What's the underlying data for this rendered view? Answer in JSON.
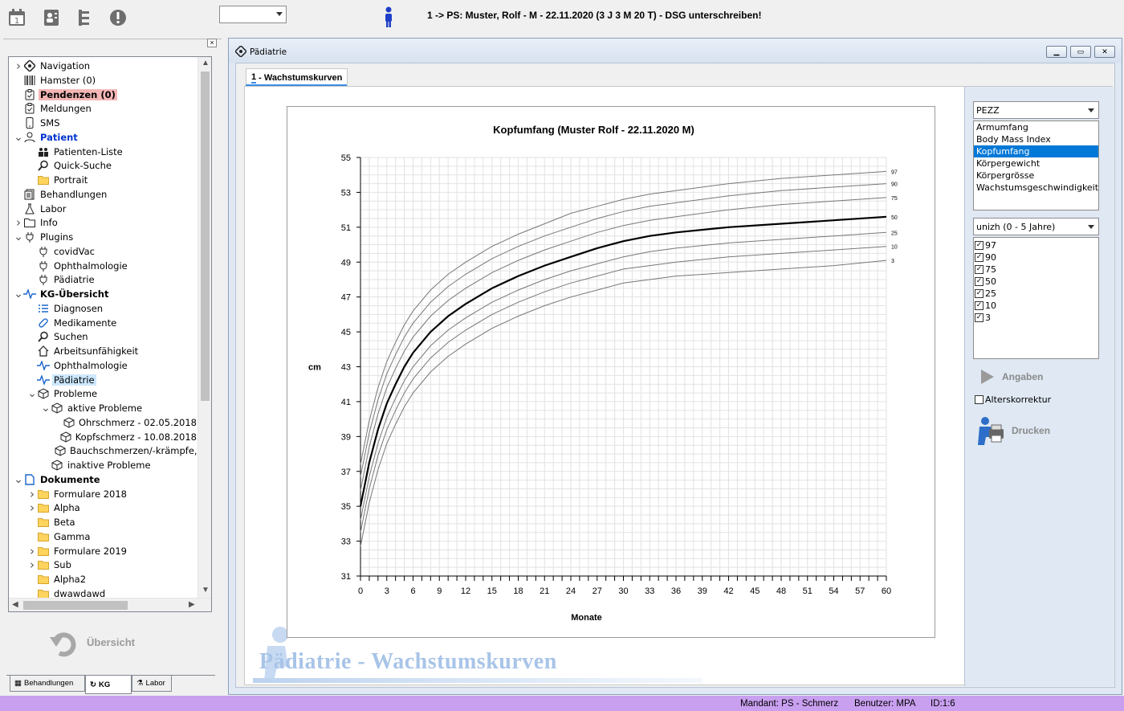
{
  "toolbar": {
    "icons": [
      "calendar-icon",
      "patient-card-icon",
      "tree-icon",
      "alert-icon"
    ],
    "combo_value": "",
    "patient_title": "1 -> PS: Muster, Rolf - M - 22.11.2020 (3 J 3 M 20 T) - DSG unterschreiben!"
  },
  "tree": {
    "items": [
      {
        "label": "Navigation"
      },
      {
        "label": "Hamster (0)"
      },
      {
        "label": "Pendenzen (0)"
      },
      {
        "label": "Meldungen"
      },
      {
        "label": "SMS"
      },
      {
        "label": "Patient"
      },
      {
        "label": "Patienten-Liste"
      },
      {
        "label": "Quick-Suche"
      },
      {
        "label": "Portrait"
      },
      {
        "label": "Behandlungen"
      },
      {
        "label": "Labor"
      },
      {
        "label": "Info"
      },
      {
        "label": "Plugins"
      },
      {
        "label": "covidVac"
      },
      {
        "label": "Ophthalmologie"
      },
      {
        "label": "Pädiatrie"
      },
      {
        "label": "KG-Übersicht"
      },
      {
        "label": "Diagnosen"
      },
      {
        "label": "Medikamente"
      },
      {
        "label": "Suchen"
      },
      {
        "label": "Arbeitsunfähigkeit"
      },
      {
        "label": "Ophthalmologie"
      },
      {
        "label": "Pädiatrie"
      },
      {
        "label": "Probleme"
      },
      {
        "label": "aktive Probleme"
      },
      {
        "label": "Ohrschmerz - 02.05.2018"
      },
      {
        "label": "Kopfschmerz - 10.08.2018"
      },
      {
        "label": "Bauchschmerzen/-krämpfe,"
      },
      {
        "label": "inaktive Probleme"
      },
      {
        "label": "Dokumente"
      },
      {
        "label": "Formulare 2018"
      },
      {
        "label": "Alpha"
      },
      {
        "label": "Beta"
      },
      {
        "label": "Gamma"
      },
      {
        "label": "Formulare 2019"
      },
      {
        "label": "Sub"
      },
      {
        "label": "Alpha2"
      },
      {
        "label": "dwawdawd"
      }
    ]
  },
  "left_bottom": {
    "uebersicht": "Übersicht",
    "tabs": [
      "Behandlungen",
      "KG",
      "Labor"
    ]
  },
  "window": {
    "title": "Pädiatrie",
    "tab_number": "1",
    "tab_label": " - Wachstumskurven",
    "watermark": "Pädiatrie - Wachstumskurven"
  },
  "right": {
    "combo1": "PEZZ",
    "measures": [
      "Armumfang",
      "Body Mass Index",
      "Kopfumfang",
      "Körpergewicht",
      "Körpergrösse",
      "Wachstumsgeschwindigkeit (k"
    ],
    "selected_measure": "Kopfumfang",
    "combo2": "unizh (0 - 5 Jahre)",
    "percentiles": [
      {
        "label": "97",
        "checked": true
      },
      {
        "label": "90",
        "checked": true
      },
      {
        "label": "75",
        "checked": true
      },
      {
        "label": "50",
        "checked": true
      },
      {
        "label": "25",
        "checked": true
      },
      {
        "label": "10",
        "checked": true
      },
      {
        "label": "3",
        "checked": true
      }
    ],
    "angaben": "Angaben",
    "alterskorrektur": "Alterskorrektur",
    "alterskorrektur_checked": false,
    "drucken": "Drucken"
  },
  "chart_data": {
    "type": "line",
    "title": "Kopfumfang (Muster Rolf - 22.11.2020 M)",
    "xlabel": "Monate",
    "ylabel": "cm",
    "xlim": [
      0,
      60
    ],
    "ylim": [
      31,
      55
    ],
    "xticks": [
      0,
      3,
      6,
      9,
      12,
      15,
      18,
      21,
      24,
      27,
      30,
      33,
      36,
      39,
      42,
      45,
      48,
      51,
      54,
      57,
      60
    ],
    "yticks": [
      31,
      33,
      35,
      37,
      39,
      41,
      43,
      45,
      47,
      49,
      51,
      53,
      55
    ],
    "grid": true,
    "x": [
      0,
      1,
      2,
      3,
      4,
      5,
      6,
      8,
      10,
      12,
      15,
      18,
      21,
      24,
      27,
      30,
      33,
      36,
      42,
      48,
      54,
      60
    ],
    "series": [
      {
        "name": "97",
        "values": [
          37.4,
          39.9,
          41.8,
          43.3,
          44.4,
          45.4,
          46.2,
          47.4,
          48.3,
          49.0,
          49.9,
          50.6,
          51.2,
          51.8,
          52.2,
          52.6,
          52.9,
          53.1,
          53.5,
          53.8,
          54.0,
          54.2
        ]
      },
      {
        "name": "90",
        "values": [
          36.7,
          39.2,
          41.1,
          42.6,
          43.7,
          44.7,
          45.5,
          46.7,
          47.6,
          48.3,
          49.2,
          49.9,
          50.5,
          51.0,
          51.5,
          51.9,
          52.2,
          52.4,
          52.8,
          53.1,
          53.3,
          53.5
        ]
      },
      {
        "name": "75",
        "values": [
          35.9,
          38.4,
          40.3,
          41.8,
          42.9,
          43.9,
          44.7,
          45.9,
          46.8,
          47.5,
          48.4,
          49.1,
          49.7,
          50.2,
          50.7,
          51.1,
          51.4,
          51.6,
          52.0,
          52.3,
          52.5,
          52.7
        ]
      },
      {
        "name": "50",
        "values": [
          35.0,
          37.5,
          39.4,
          40.9,
          42.0,
          43.0,
          43.8,
          45.0,
          45.9,
          46.6,
          47.5,
          48.2,
          48.8,
          49.3,
          49.8,
          50.2,
          50.5,
          50.7,
          51.0,
          51.2,
          51.4,
          51.6
        ]
      },
      {
        "name": "25",
        "values": [
          34.2,
          36.7,
          38.6,
          40.1,
          41.2,
          42.2,
          43.0,
          44.2,
          45.1,
          45.8,
          46.7,
          47.4,
          48.0,
          48.5,
          48.9,
          49.3,
          49.6,
          49.8,
          50.1,
          50.3,
          50.5,
          50.7
        ]
      },
      {
        "name": "10",
        "values": [
          33.5,
          36.0,
          37.9,
          39.4,
          40.5,
          41.5,
          42.3,
          43.5,
          44.4,
          45.1,
          46.0,
          46.7,
          47.3,
          47.8,
          48.2,
          48.6,
          48.8,
          49.0,
          49.3,
          49.5,
          49.7,
          49.9
        ]
      },
      {
        "name": "3",
        "values": [
          32.7,
          35.2,
          37.1,
          38.6,
          39.7,
          40.7,
          41.5,
          42.7,
          43.6,
          44.3,
          45.2,
          45.9,
          46.5,
          47.0,
          47.4,
          47.8,
          48.0,
          48.2,
          48.4,
          48.6,
          48.8,
          49.1
        ]
      }
    ]
  },
  "status": {
    "mandant": "Mandant: PS - Schmerz",
    "benutzer": "Benutzer: MPA",
    "id": "ID:1:6"
  }
}
